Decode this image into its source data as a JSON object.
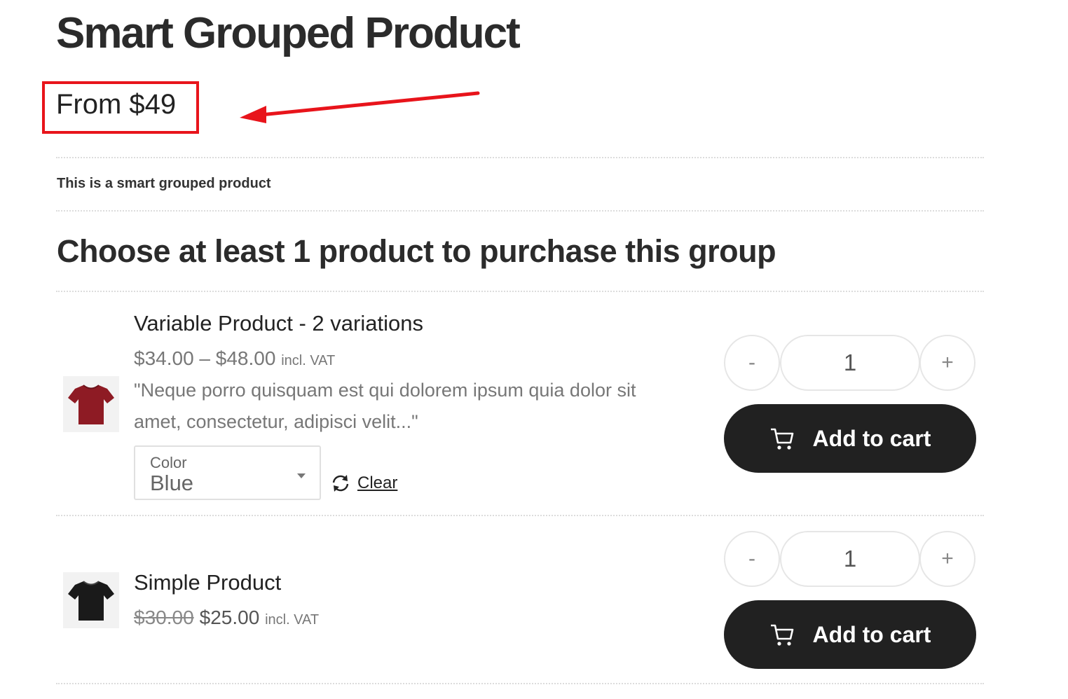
{
  "product": {
    "title": "Smart Grouped Product",
    "price_from": "From $49",
    "short_description": "This is a smart grouped product"
  },
  "group": {
    "heading": "Choose at least 1 product to purchase this group"
  },
  "items": [
    {
      "name": "Variable Product - 2 variations",
      "price_range": "$34.00 – $48.00",
      "vat_label": "incl. VAT",
      "excerpt": "\"Neque porro quisquam est qui dolorem ipsum quia dolor sit amet, consectetur, adipisci velit...\"",
      "variation": {
        "label": "Color",
        "value": "Blue"
      },
      "clear_label": "Clear",
      "qty": {
        "minus": "-",
        "value": "1",
        "plus": "+"
      },
      "cart_label": "Add to cart",
      "thumb_color": "#8e1b24"
    },
    {
      "name": "Simple Product",
      "old_price": "$30.00",
      "new_price": "$25.00",
      "vat_label": "incl. VAT",
      "qty": {
        "minus": "-",
        "value": "1",
        "plus": "+"
      },
      "cart_label": "Add to cart",
      "thumb_color": "#1a1a1a"
    }
  ],
  "annotation": {
    "highlight_color": "#e8141b"
  },
  "icons": {
    "cart": "cart-icon",
    "clear": "refresh-icon",
    "caret": "caret-down-icon",
    "arrow": "arrow-left-icon"
  }
}
